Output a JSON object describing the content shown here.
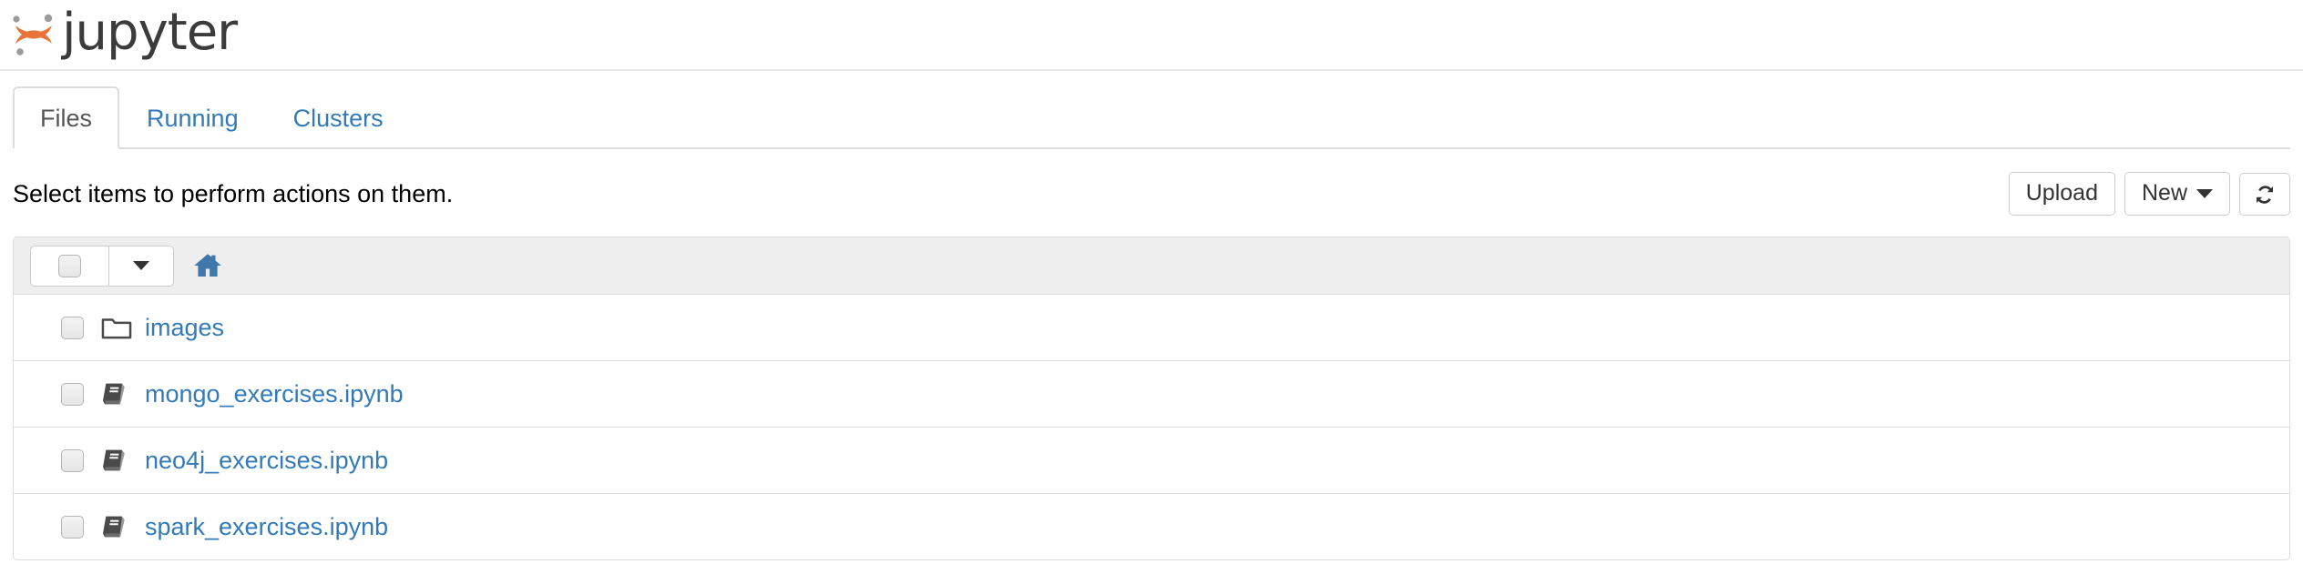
{
  "brand": {
    "name": "jupyter",
    "logo_icon": "jupyter-logo-icon",
    "logo_arc_color": "#e8743b",
    "logo_dot_color": "#9b9b9b",
    "wordmark_color": "#3b3b3b"
  },
  "tabs": [
    {
      "label": "Files",
      "active": true,
      "name": "tab-files"
    },
    {
      "label": "Running",
      "active": false,
      "name": "tab-running"
    },
    {
      "label": "Clusters",
      "active": false,
      "name": "tab-clusters"
    }
  ],
  "toolbar": {
    "alert_text": "Select items to perform actions on them.",
    "upload_label": "Upload",
    "new_label": "New",
    "new_caret_icon": "chevron-down-icon",
    "refresh_icon": "refresh-icon"
  },
  "list_header": {
    "select_all_checkbox_checked": false,
    "select_all_caret_icon": "chevron-down-icon",
    "breadcrumb_home_icon": "home-icon",
    "breadcrumb_home_color": "#4178ab"
  },
  "files": [
    {
      "name": "images",
      "type": "folder",
      "icon": "folder-icon",
      "checked": false
    },
    {
      "name": "mongo_exercises.ipynb",
      "type": "notebook",
      "icon": "notebook-icon",
      "checked": false
    },
    {
      "name": "neo4j_exercises.ipynb",
      "type": "notebook",
      "icon": "notebook-icon",
      "checked": false
    },
    {
      "name": "spark_exercises.ipynb",
      "type": "notebook",
      "icon": "notebook-icon",
      "checked": false
    }
  ],
  "colors": {
    "link_blue": "#337ab7",
    "header_gray": "#eeeeee",
    "border_gray": "#dddddd",
    "text_dark": "#333333"
  }
}
